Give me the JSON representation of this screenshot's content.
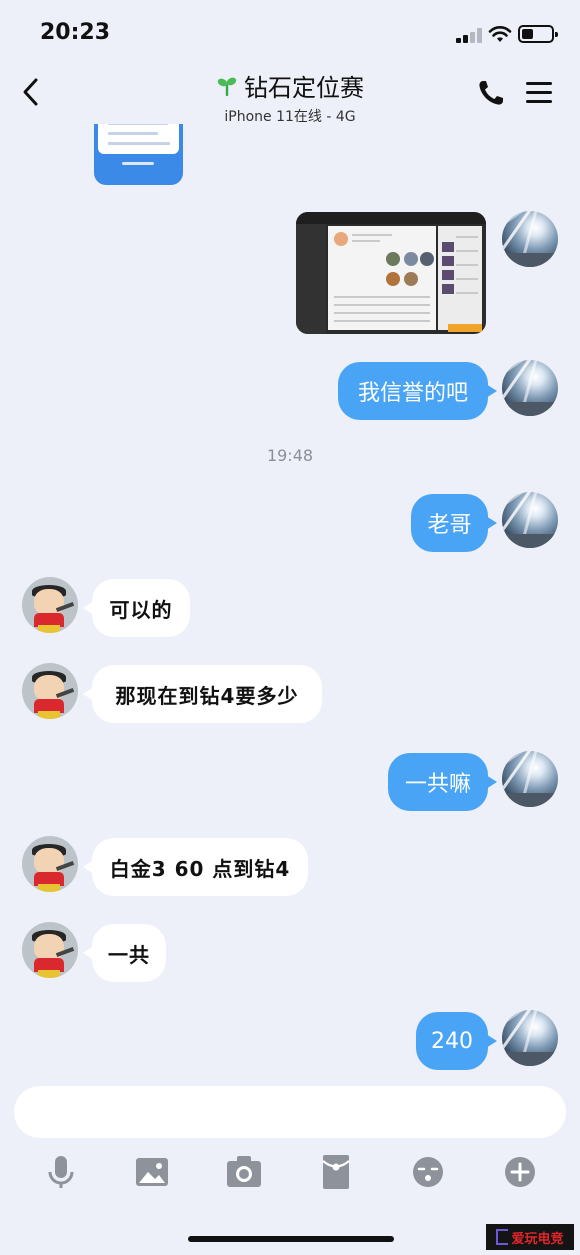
{
  "status_bar": {
    "time": "20:23"
  },
  "header": {
    "title": "钻石定位赛",
    "subtitle": "iPhone 11在线 - 4G"
  },
  "messages": [
    {
      "type": "image",
      "side": "out",
      "description_icon": "screenshot-thumbnail"
    },
    {
      "type": "text",
      "side": "out",
      "text": "我信誉的吧"
    },
    {
      "type": "time",
      "text": "19:48"
    },
    {
      "type": "text",
      "side": "out",
      "text": "老哥"
    },
    {
      "type": "text",
      "side": "in",
      "text": "可以的"
    },
    {
      "type": "text",
      "side": "in",
      "text": "那现在到钻4要多少"
    },
    {
      "type": "text",
      "side": "out",
      "text": "一共嘛"
    },
    {
      "type": "text",
      "side": "in",
      "text": "白金3 60 点到钻4"
    },
    {
      "type": "text",
      "side": "in",
      "text": "一共"
    },
    {
      "type": "text",
      "side": "out",
      "text": "240"
    }
  ],
  "toolbar": {
    "icons": [
      "microphone-icon",
      "image-icon",
      "camera-icon",
      "red-packet-icon",
      "emoji-icon",
      "plus-icon"
    ]
  },
  "watermark": {
    "brand": "爱玩电竞"
  },
  "colors": {
    "background": "#edf0f8",
    "outgoing_bubble": "#4aa4f5",
    "incoming_bubble": "#ffffff",
    "icon_gray": "#8e939b"
  }
}
